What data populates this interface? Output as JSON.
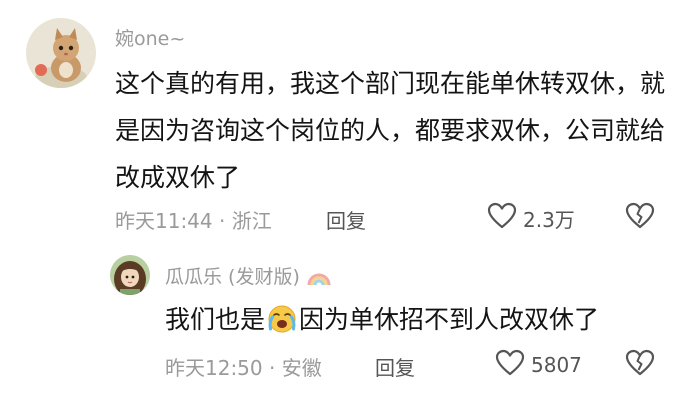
{
  "comment": {
    "username": "婉one~",
    "text": "这个真的有用，我这个部门现在能单休转双休，就是因为咨询这个岗位的人，都要求双休，公司就给改成双休了",
    "meta": "昨天11:44 · 浙江",
    "reply_label": "回复",
    "like_count": "2.3万",
    "avatar_icon": "kitten-avatar",
    "like_icon": "heart-outline-icon",
    "dislike_icon": "broken-heart-icon"
  },
  "reply": {
    "username": "瓜瓜乐 (发财版)",
    "badge_icon": "rainbow-icon",
    "text_before": "我们也是",
    "emoji_icon": "crying-face-icon",
    "text_after": "因为单休招不到人改双休了",
    "meta": "昨天12:50 · 安徽",
    "reply_label": "回复",
    "like_count": "5807",
    "avatar_icon": "girl-avatar",
    "like_icon": "heart-outline-icon",
    "dislike_icon": "broken-heart-icon"
  },
  "colors": {
    "text": "#141414",
    "muted": "#9a9a9a",
    "action": "#555555",
    "background": "#ffffff"
  }
}
